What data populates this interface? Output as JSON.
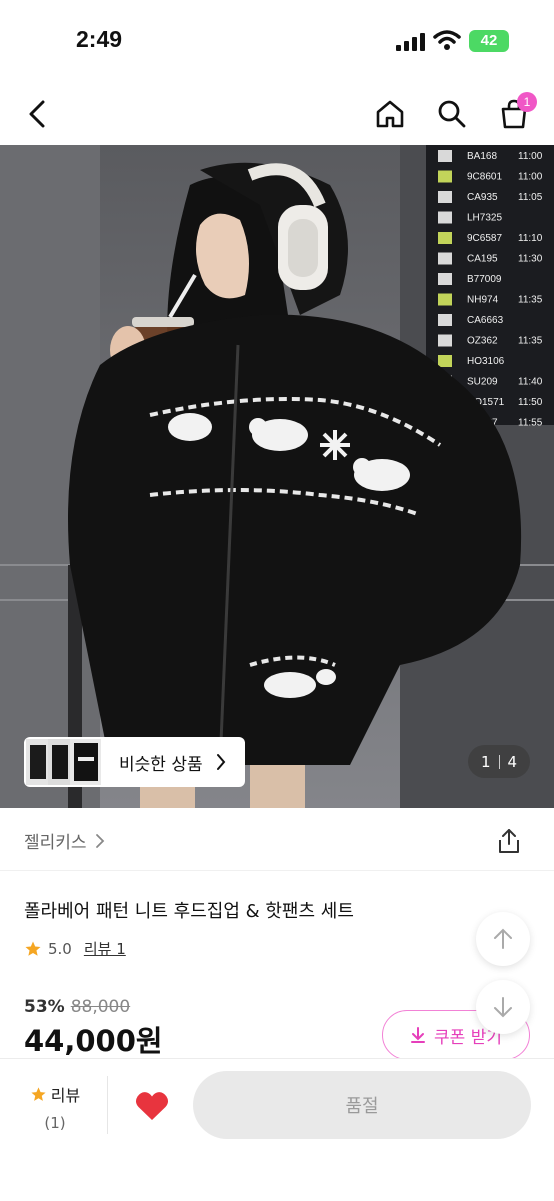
{
  "status_bar": {
    "time": "2:49",
    "battery": "42"
  },
  "header": {
    "cart_count": "1",
    "icons": [
      "back-arrow-icon",
      "home-icon",
      "search-icon",
      "shopping-bag-icon"
    ]
  },
  "hero": {
    "similar_label": "비슷한 상품",
    "page_current": "1",
    "page_total": "4",
    "board_rows": [
      {
        "flight": "BA168",
        "time": "11:00"
      },
      {
        "flight": "9C8601",
        "time": "11:00"
      },
      {
        "flight": "CA935",
        "time": "11:05"
      },
      {
        "flight": "LH7325",
        "time": ""
      },
      {
        "flight": "9C6587",
        "time": "11:10"
      },
      {
        "flight": "CA195",
        "time": "11:30"
      },
      {
        "flight": "B77009",
        "time": ""
      },
      {
        "flight": "NH974",
        "time": "11:35"
      },
      {
        "flight": "CA6663",
        "time": ""
      },
      {
        "flight": "OZ362",
        "time": "11:35"
      },
      {
        "flight": "HO3106",
        "time": ""
      },
      {
        "flight": "SU209",
        "time": "11:40"
      },
      {
        "flight": "HO1571",
        "time": "11:50"
      },
      {
        "flight": "HX237",
        "time": "11:55"
      }
    ]
  },
  "product": {
    "brand": "젤리키스",
    "title": "폴라베어 패턴 니트 후드집업 & 핫팬츠 세트",
    "rating": "5.0",
    "review_link": "리뷰 1",
    "discount_rate": "53%",
    "original_price": "88,000",
    "sale_price": "44,000원",
    "coupon_label": "쿠폰 받기"
  },
  "bottom_bar": {
    "review_label": "리뷰",
    "review_count": "(1)",
    "buy_label": "품절"
  },
  "colors": {
    "accent": "#e63fbb",
    "badge": "#f057c6",
    "heart": "#e8343e",
    "star": "#f5a623"
  }
}
